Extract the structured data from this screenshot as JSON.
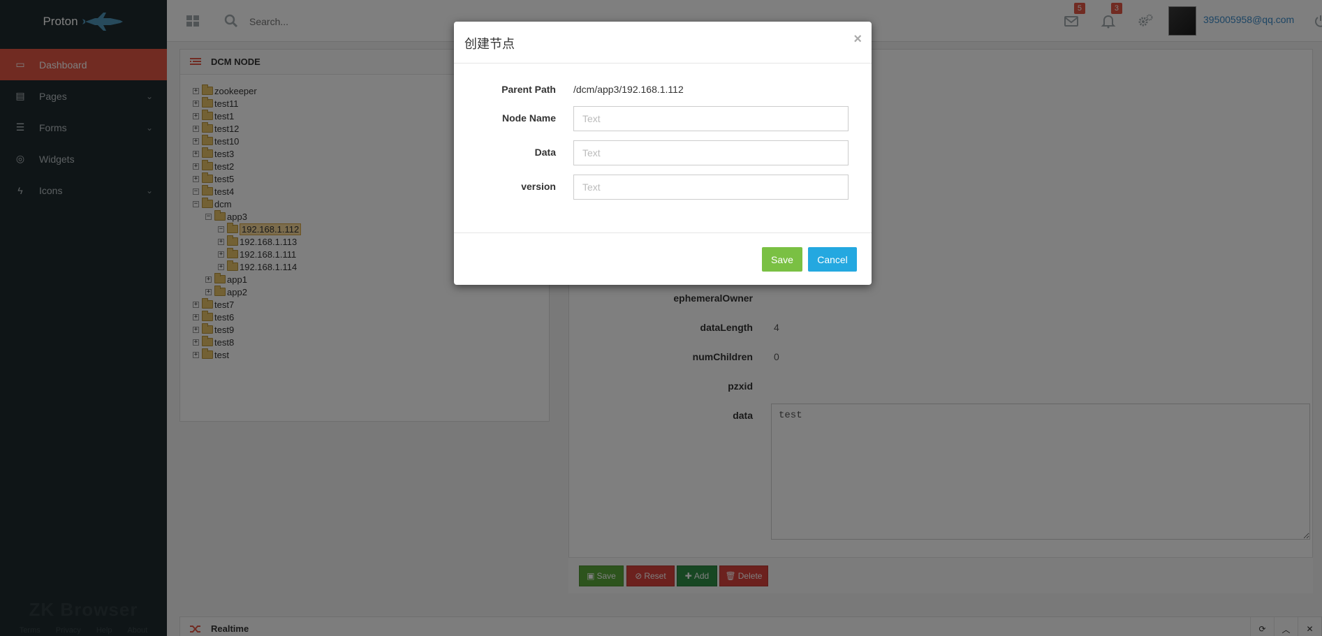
{
  "brand": {
    "name": "Proton"
  },
  "sidebar": {
    "items": [
      {
        "label": "Dashboard",
        "icon": "laptop-icon",
        "active": true,
        "has_submenu": false
      },
      {
        "label": "Pages",
        "icon": "file-icon",
        "active": false,
        "has_submenu": true
      },
      {
        "label": "Forms",
        "icon": "list-icon",
        "active": false,
        "has_submenu": true
      },
      {
        "label": "Widgets",
        "icon": "life-ring-icon",
        "active": false,
        "has_submenu": false
      },
      {
        "label": "Icons",
        "icon": "bolt-icon",
        "active": false,
        "has_submenu": true
      }
    ],
    "footer_logo": "ZK Browser",
    "footer_links": [
      "Terms",
      "Privacy",
      "Help",
      "About"
    ]
  },
  "topbar": {
    "search_placeholder": "Search...",
    "mail_count": "5",
    "notification_count": "3",
    "user_email": "395005958@qq.com"
  },
  "tree_panel": {
    "title": "DCM NODE",
    "nodes": [
      {
        "label": "zookeeper",
        "depth": 0,
        "expanded": false,
        "selected": false
      },
      {
        "label": "test11",
        "depth": 0,
        "expanded": false,
        "selected": false
      },
      {
        "label": "test1",
        "depth": 0,
        "expanded": false,
        "selected": false
      },
      {
        "label": "test12",
        "depth": 0,
        "expanded": false,
        "selected": false
      },
      {
        "label": "test10",
        "depth": 0,
        "expanded": false,
        "selected": false
      },
      {
        "label": "test3",
        "depth": 0,
        "expanded": false,
        "selected": false
      },
      {
        "label": "test2",
        "depth": 0,
        "expanded": false,
        "selected": false
      },
      {
        "label": "test5",
        "depth": 0,
        "expanded": false,
        "selected": false
      },
      {
        "label": "test4",
        "depth": 0,
        "expanded": true,
        "selected": false
      },
      {
        "label": "dcm",
        "depth": 0,
        "expanded": true,
        "selected": false
      },
      {
        "label": "app3",
        "depth": 1,
        "expanded": true,
        "selected": false
      },
      {
        "label": "192.168.1.112",
        "depth": 2,
        "expanded": true,
        "selected": true
      },
      {
        "label": "192.168.1.113",
        "depth": 2,
        "expanded": false,
        "selected": false
      },
      {
        "label": "192.168.1.111",
        "depth": 2,
        "expanded": false,
        "selected": false
      },
      {
        "label": "192.168.1.114",
        "depth": 2,
        "expanded": false,
        "selected": false
      },
      {
        "label": "app1",
        "depth": 1,
        "expanded": false,
        "selected": false
      },
      {
        "label": "app2",
        "depth": 1,
        "expanded": false,
        "selected": false
      },
      {
        "label": "test7",
        "depth": 0,
        "expanded": false,
        "selected": false
      },
      {
        "label": "test6",
        "depth": 0,
        "expanded": false,
        "selected": false
      },
      {
        "label": "test9",
        "depth": 0,
        "expanded": false,
        "selected": false
      },
      {
        "label": "test8",
        "depth": 0,
        "expanded": false,
        "selected": false
      },
      {
        "label": "test",
        "depth": 0,
        "expanded": false,
        "selected": false
      }
    ]
  },
  "detail": {
    "props": [
      {
        "key": "ephemeralOwner",
        "value": ""
      },
      {
        "key": "dataLength",
        "value": "4"
      },
      {
        "key": "numChildren",
        "value": "0"
      },
      {
        "key": "pzxid",
        "value": ""
      },
      {
        "key": "data",
        "value": ""
      }
    ],
    "data_value": "test",
    "buttons": {
      "save": "Save",
      "reset": "Reset",
      "add": "Add",
      "delete": "Delete"
    }
  },
  "realtime": {
    "title": "Realtime"
  },
  "modal": {
    "title": "创建节点",
    "close": "×",
    "parent_path_label": "Parent Path",
    "parent_path_value": "/dcm/app3/192.168.1.112",
    "node_name_label": "Node Name",
    "node_name_placeholder": "Text",
    "data_label": "Data",
    "data_placeholder": "Text",
    "version_label": "version",
    "version_placeholder": "Text",
    "save_label": "Save",
    "cancel_label": "Cancel"
  },
  "colors": {
    "sidebar_bg": "#1f2a2e",
    "active_nav": "#e25745",
    "save_green": "#7ac043",
    "cancel_blue": "#24a8e0",
    "email_link": "#3b8bc9"
  }
}
